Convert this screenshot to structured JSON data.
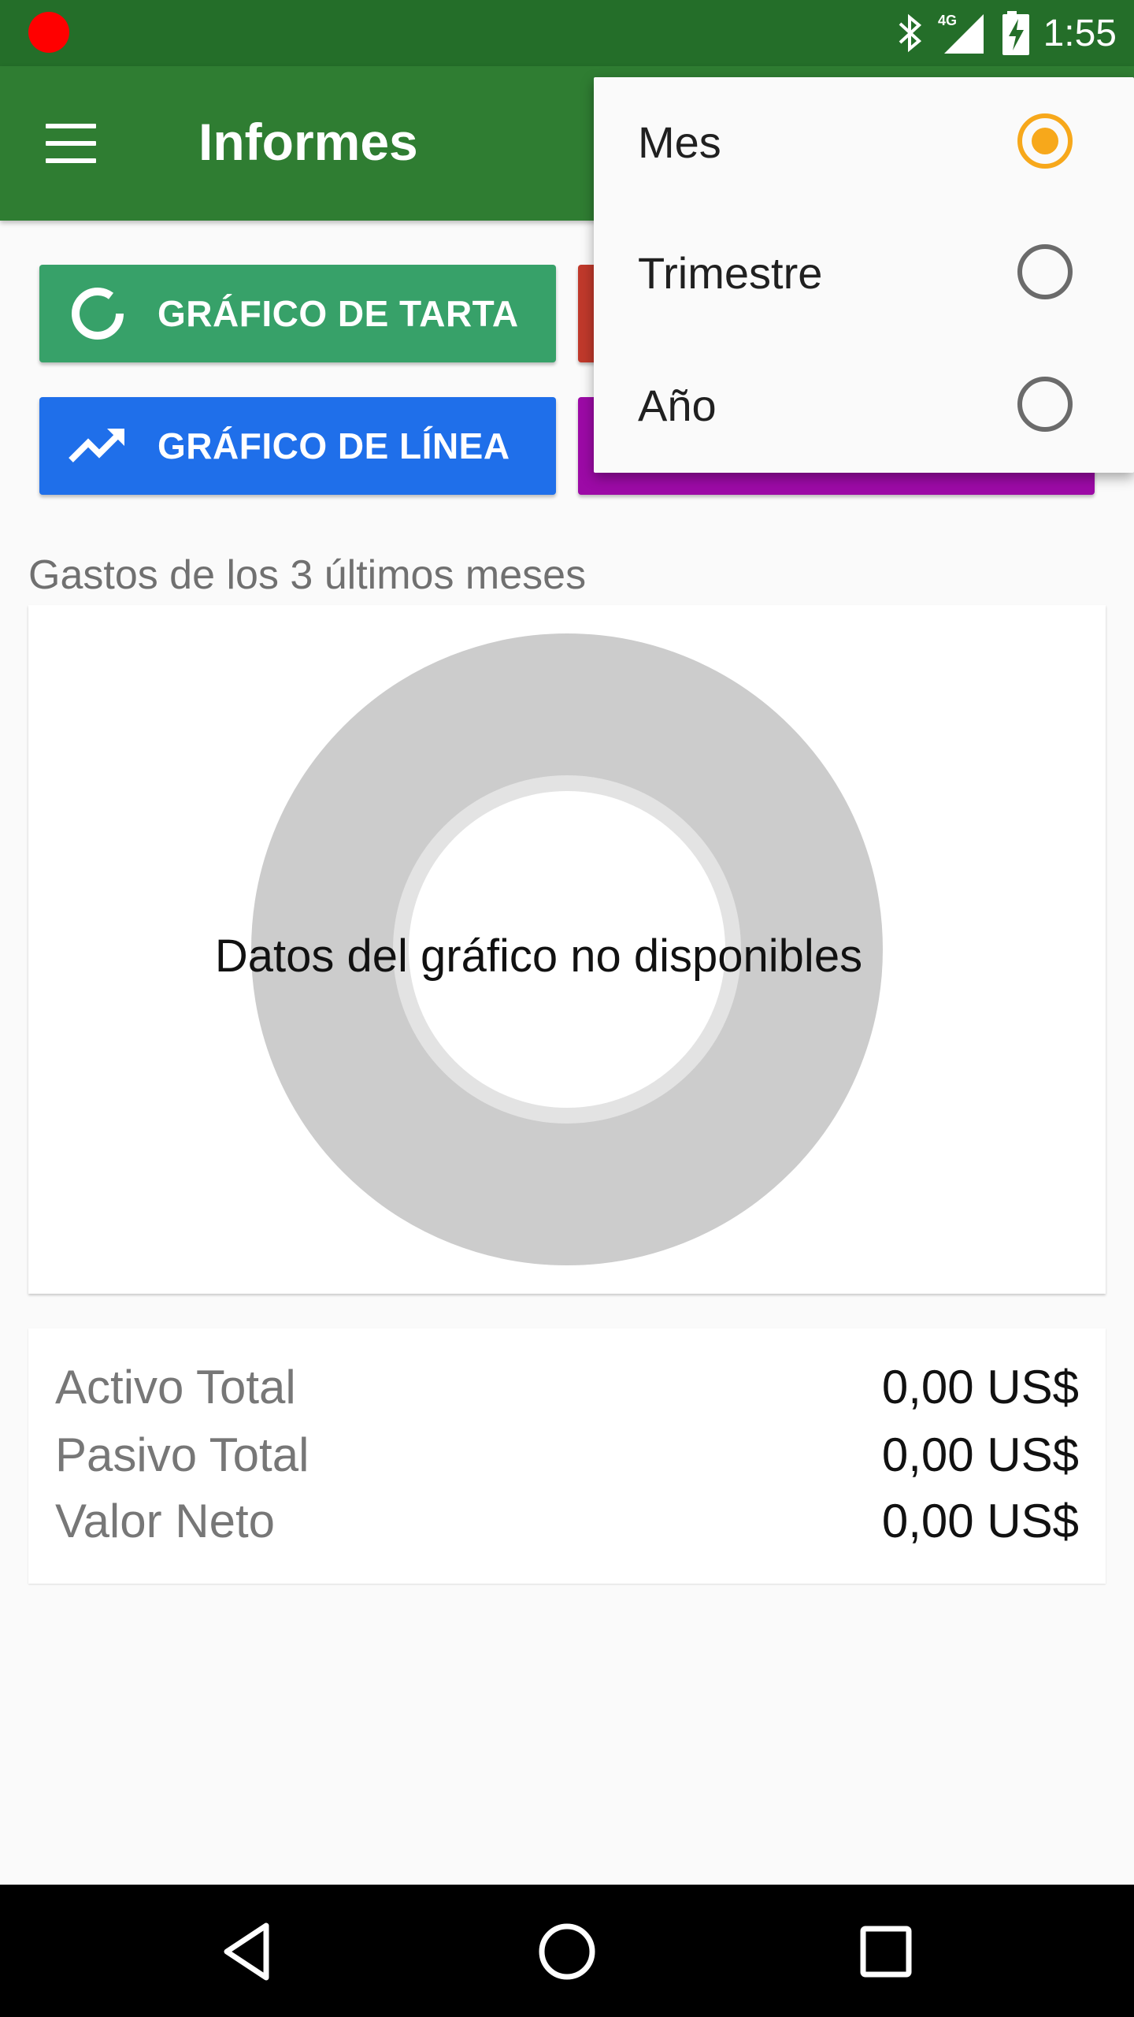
{
  "status_bar": {
    "time": "1:55",
    "network": "4G"
  },
  "app_bar": {
    "title": "Informes"
  },
  "buttons": {
    "pie": "GRÁFICO DE TARTA",
    "bar": "",
    "line": "GRÁFICO DE LÍNEA",
    "table": ""
  },
  "report": {
    "title": "Gastos de los 3 últimos meses",
    "no_data": "Datos del gráfico no disponibles"
  },
  "totals": [
    {
      "label": "Activo Total",
      "value": "0,00 US$"
    },
    {
      "label": "Pasivo Total",
      "value": "0,00 US$"
    },
    {
      "label": "Valor Neto",
      "value": "0,00 US$"
    }
  ],
  "period_menu": {
    "items": [
      {
        "label": "Mes",
        "selected": true
      },
      {
        "label": "Trimestre",
        "selected": false
      },
      {
        "label": "Año",
        "selected": false
      }
    ]
  },
  "colors": {
    "status_bar": "#246e29",
    "app_bar": "#2f7d32",
    "pie_button": "#37a169",
    "bar_button": "#c0392b",
    "line_button": "#1f6fea",
    "table_button": "#9c0aa6",
    "radio_selected": "#f7a81b"
  }
}
